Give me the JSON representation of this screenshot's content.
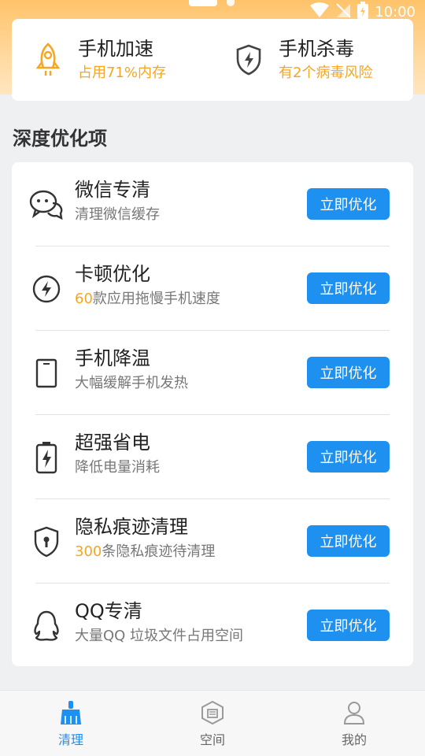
{
  "status": {
    "time": "10:00"
  },
  "quick": [
    {
      "title": "手机加速",
      "sub": "占用71%内存",
      "icon": "rocket-icon"
    },
    {
      "title": "手机杀毒",
      "sub": "有2个病毒风险",
      "icon": "shield-bolt-icon"
    }
  ],
  "section_title": "深度优化项",
  "items": [
    {
      "title": "微信专清",
      "sub_highlight": "",
      "sub": "清理微信缓存",
      "button": "立即优化",
      "icon": "wechat-icon"
    },
    {
      "title": "卡顿优化",
      "sub_highlight": "60",
      "sub": "款应用拖慢手机速度",
      "button": "立即优化",
      "icon": "lightning-circle-icon"
    },
    {
      "title": "手机降温",
      "sub_highlight": "",
      "sub": "大幅缓解手机发热",
      "button": "立即优化",
      "icon": "phone-icon"
    },
    {
      "title": "超强省电",
      "sub_highlight": "",
      "sub": "降低电量消耗",
      "button": "立即优化",
      "icon": "battery-icon"
    },
    {
      "title": "隐私痕迹清理",
      "sub_highlight": "300",
      "sub": "条隐私痕迹待清理",
      "button": "立即优化",
      "icon": "privacy-shield-icon"
    },
    {
      "title": "QQ专清",
      "sub_highlight": "",
      "sub": "大量QQ 垃圾文件占用空间",
      "button": "立即优化",
      "icon": "qq-icon"
    }
  ],
  "nav": [
    {
      "label": "清理",
      "active": true,
      "icon": "broom-icon"
    },
    {
      "label": "空间",
      "active": false,
      "icon": "storage-icon"
    },
    {
      "label": "我的",
      "active": false,
      "icon": "user-icon"
    }
  ],
  "colors": {
    "accent": "#1e90f0",
    "highlight": "#f5a623",
    "header_gradient": "#ffc36a"
  }
}
